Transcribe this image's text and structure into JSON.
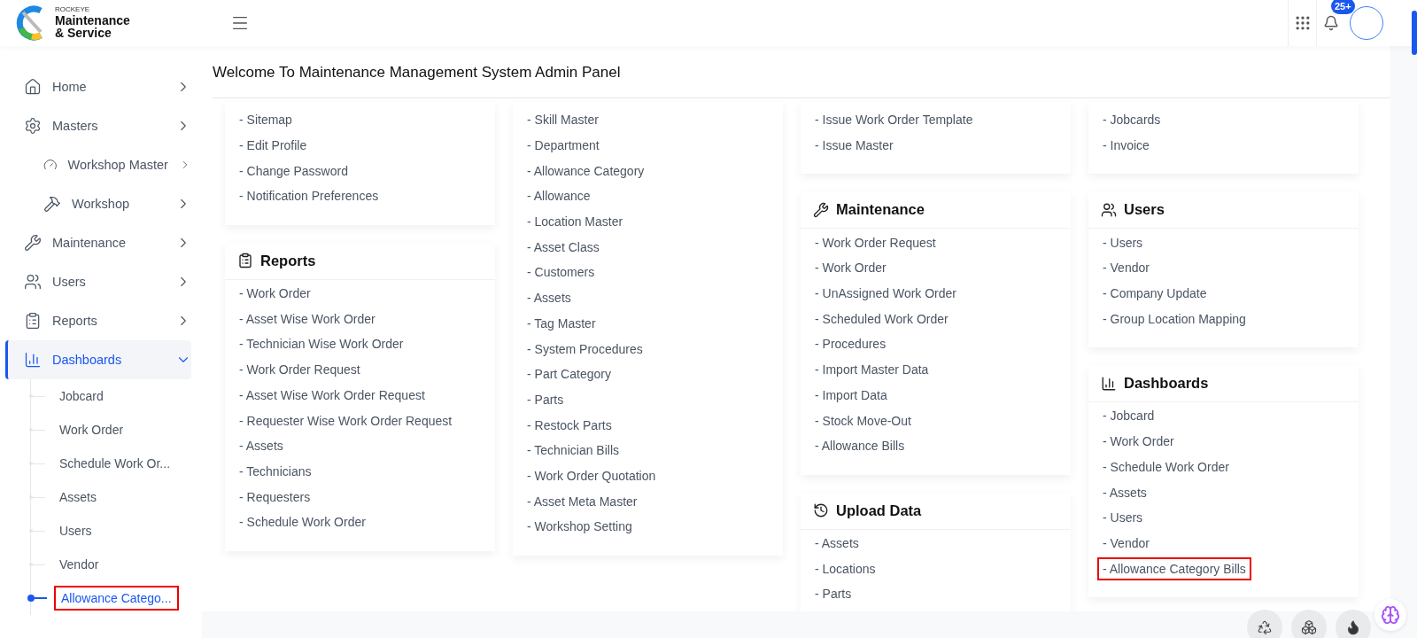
{
  "brand": {
    "small": "ROCKEYE",
    "name_line1": "Maintenance",
    "name_line2": "& Service"
  },
  "topbar": {
    "notifications_badge": "25+"
  },
  "sidebar": {
    "items": [
      {
        "label": "Home",
        "selected": false,
        "expanded": false
      },
      {
        "label": "Masters",
        "selected": false,
        "expanded": false
      },
      {
        "label": "Workshop Master",
        "selected": false,
        "expanded": false
      },
      {
        "label": "Workshop",
        "selected": false,
        "expanded": false
      },
      {
        "label": "Maintenance",
        "selected": false,
        "expanded": false
      },
      {
        "label": "Users",
        "selected": false,
        "expanded": false
      },
      {
        "label": "Reports",
        "selected": false,
        "expanded": false
      },
      {
        "label": "Dashboards",
        "selected": true,
        "expanded": true,
        "children": [
          {
            "label": "Jobcard",
            "selected": false,
            "outlined": false
          },
          {
            "label": "Work Order",
            "selected": false,
            "outlined": false
          },
          {
            "label": "Schedule Work Or...",
            "selected": false,
            "outlined": false
          },
          {
            "label": "Assets",
            "selected": false,
            "outlined": false
          },
          {
            "label": "Users",
            "selected": false,
            "outlined": false
          },
          {
            "label": "Vendor",
            "selected": false,
            "outlined": false
          },
          {
            "label": "Allowance Catego...",
            "selected": true,
            "outlined": true
          }
        ]
      }
    ]
  },
  "page_title": "Welcome To Maintenance Management System Admin Panel",
  "columns": [
    [
      {
        "links": [
          {
            "label": "- Sitemap",
            "outlined": false
          },
          {
            "label": "- Edit Profile",
            "outlined": false
          },
          {
            "label": "- Change Password",
            "outlined": false
          },
          {
            "label": "- Notification Preferences",
            "outlined": false
          }
        ]
      },
      {
        "title": "Reports",
        "links": [
          {
            "label": "- Work Order",
            "outlined": false
          },
          {
            "label": "- Asset Wise Work Order",
            "outlined": false
          },
          {
            "label": "- Technician Wise Work Order",
            "outlined": false
          },
          {
            "label": "- Work Order Request",
            "outlined": false
          },
          {
            "label": "- Asset Wise Work Order Request",
            "outlined": false
          },
          {
            "label": "- Requester Wise Work Order Request",
            "outlined": false
          },
          {
            "label": "- Assets",
            "outlined": false
          },
          {
            "label": "- Technicians",
            "outlined": false
          },
          {
            "label": "- Requesters",
            "outlined": false
          },
          {
            "label": "- Schedule Work Order",
            "outlined": false
          }
        ]
      }
    ],
    [
      {
        "links": [
          {
            "label": "- Skill Master",
            "outlined": false
          },
          {
            "label": "- Department",
            "outlined": false
          },
          {
            "label": "- Allowance Category",
            "outlined": false
          },
          {
            "label": "- Allowance",
            "outlined": false
          },
          {
            "label": "- Location Master",
            "outlined": false
          },
          {
            "label": "- Asset Class",
            "outlined": false
          },
          {
            "label": "- Customers",
            "outlined": false
          },
          {
            "label": "- Assets",
            "outlined": false
          },
          {
            "label": "- Tag Master",
            "outlined": false
          },
          {
            "label": "- System Procedures",
            "outlined": false
          },
          {
            "label": "- Part Category",
            "outlined": false
          },
          {
            "label": "- Parts",
            "outlined": false
          },
          {
            "label": "- Restock Parts",
            "outlined": false
          },
          {
            "label": "- Technician Bills",
            "outlined": false
          },
          {
            "label": "- Work Order Quotation",
            "outlined": false
          },
          {
            "label": "- Asset Meta Master",
            "outlined": false
          },
          {
            "label": "- Workshop Setting",
            "outlined": false
          }
        ]
      }
    ],
    [
      {
        "links": [
          {
            "label": "- Issue Work Order Template",
            "outlined": false
          },
          {
            "label": "- Issue Master",
            "outlined": false
          }
        ]
      },
      {
        "title": "Maintenance",
        "links": [
          {
            "label": "- Work Order Request",
            "outlined": false
          },
          {
            "label": "- Work Order",
            "outlined": false
          },
          {
            "label": "- UnAssigned Work Order",
            "outlined": false
          },
          {
            "label": "- Scheduled Work Order",
            "outlined": false
          },
          {
            "label": "- Procedures",
            "outlined": false
          },
          {
            "label": "- Import Master Data",
            "outlined": false
          },
          {
            "label": "- Import Data",
            "outlined": false
          },
          {
            "label": "- Stock Move-Out",
            "outlined": false
          },
          {
            "label": "- Allowance Bills",
            "outlined": false
          }
        ]
      },
      {
        "title": "Upload Data",
        "links": [
          {
            "label": "- Assets",
            "outlined": false
          },
          {
            "label": "- Locations",
            "outlined": false
          },
          {
            "label": "- Parts",
            "outlined": false
          }
        ]
      }
    ],
    [
      {
        "links": [
          {
            "label": "- Jobcards",
            "outlined": false
          },
          {
            "label": "- Invoice",
            "outlined": false
          }
        ]
      },
      {
        "title": "Users",
        "links": [
          {
            "label": "- Users",
            "outlined": false
          },
          {
            "label": "- Vendor",
            "outlined": false
          },
          {
            "label": "- Company Update",
            "outlined": false
          },
          {
            "label": "- Group Location Mapping",
            "outlined": false
          }
        ]
      },
      {
        "title": "Dashboards",
        "links": [
          {
            "label": "- Jobcard",
            "outlined": false
          },
          {
            "label": "- Work Order",
            "outlined": false
          },
          {
            "label": "- Schedule Work Order",
            "outlined": false
          },
          {
            "label": "- Assets",
            "outlined": false
          },
          {
            "label": "- Users",
            "outlined": false
          },
          {
            "label": "- Vendor",
            "outlined": false
          },
          {
            "label": "- Allowance Category Bills",
            "outlined": true
          }
        ]
      }
    ]
  ]
}
